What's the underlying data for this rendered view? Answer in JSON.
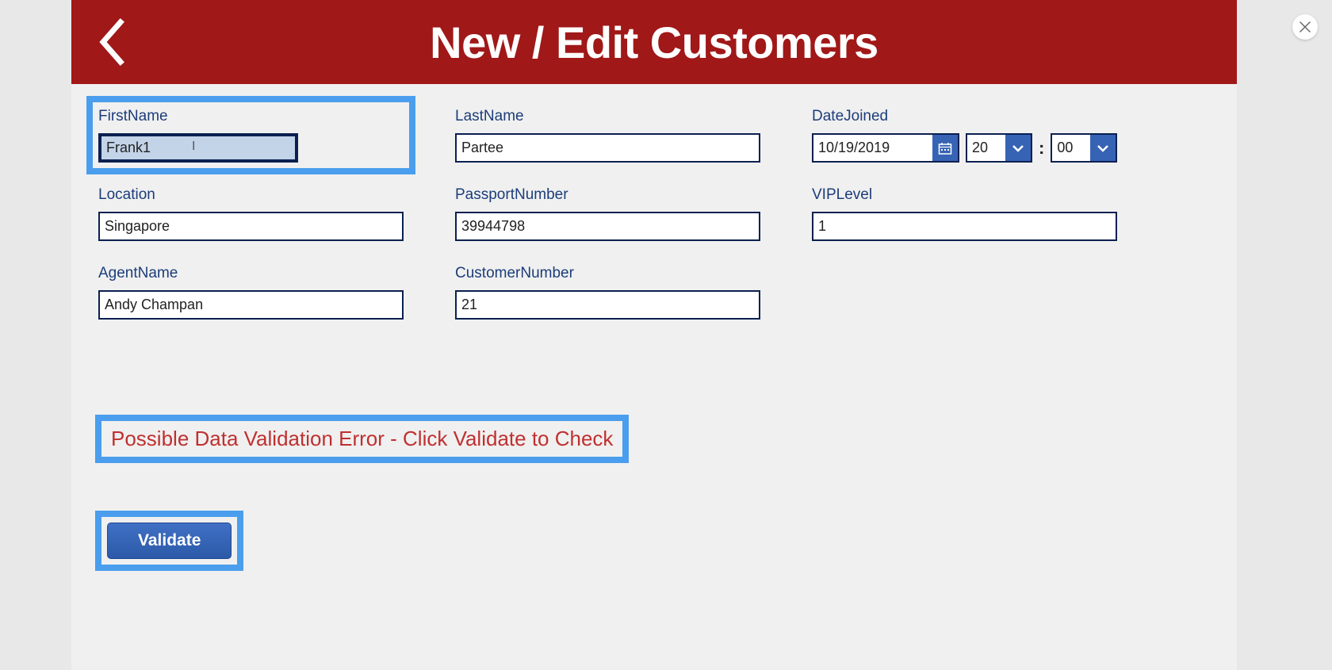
{
  "header": {
    "title": "New / Edit Customers"
  },
  "fields": {
    "firstName": {
      "label": "FirstName",
      "value": "Frank1"
    },
    "lastName": {
      "label": "LastName",
      "value": "Partee"
    },
    "dateJoined": {
      "label": "DateJoined",
      "date": "10/19/2019",
      "hour": "20",
      "minute": "00",
      "separator": ":"
    },
    "location": {
      "label": "Location",
      "value": "Singapore"
    },
    "passportNumber": {
      "label": "PassportNumber",
      "value": "39944798"
    },
    "vipLevel": {
      "label": "VIPLevel",
      "value": "1"
    },
    "agentName": {
      "label": "AgentName",
      "value": "Andy Champan"
    },
    "customerNumber": {
      "label": "CustomerNumber",
      "value": "21"
    }
  },
  "validation": {
    "message": "Possible Data Validation Error - Click Validate to Check"
  },
  "buttons": {
    "validate": "Validate"
  }
}
